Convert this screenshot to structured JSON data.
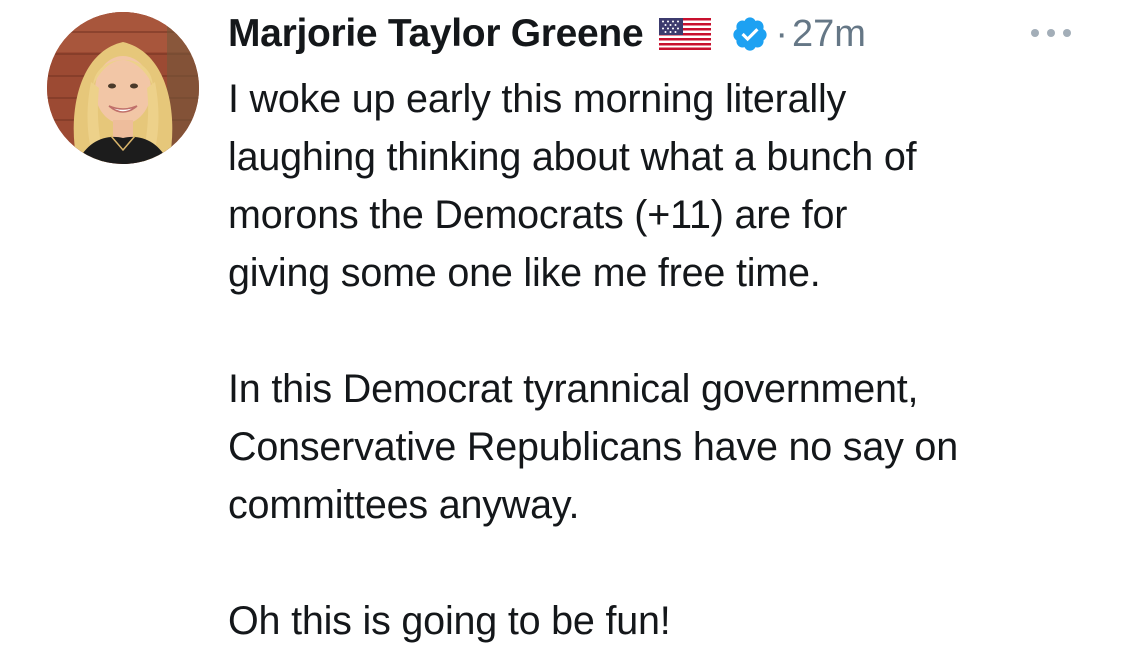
{
  "tweet": {
    "author": {
      "display_name": "Marjorie Taylor Greene",
      "flag_icon": "us-flag-icon",
      "verified_icon": "verified-badge-icon",
      "avatar": "avatar-photo"
    },
    "separator": "·",
    "timestamp": "27m",
    "more_icon": "ellipsis-icon",
    "paragraphs": [
      {
        "lines": [
          "I woke up early this morning literally",
          "laughing thinking about what a bunch of",
          "morons the Democrats (+11) are for",
          "giving some one like me free time."
        ]
      },
      {
        "lines": [
          "In this Democrat tyrannical government,",
          "Conservative Republicans have no say on",
          "committees anyway."
        ]
      },
      {
        "lines": [
          "Oh this is going to be fun!"
        ]
      }
    ]
  },
  "colors": {
    "text": "#14171a",
    "secondary": "#657786",
    "verified_blue": "#1da1f2",
    "background": "#ffffff"
  }
}
